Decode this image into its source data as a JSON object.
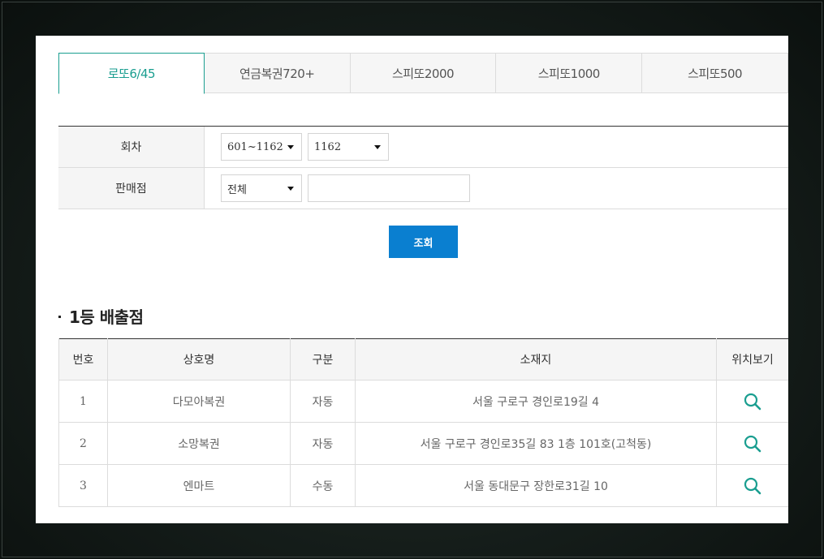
{
  "tabs": [
    {
      "label": "로또6/45",
      "active": true
    },
    {
      "label": "연금복권720+",
      "active": false
    },
    {
      "label": "스피또2000",
      "active": false
    },
    {
      "label": "스피또1000",
      "active": false
    },
    {
      "label": "스피또500",
      "active": false
    }
  ],
  "search": {
    "round_label": "회차",
    "round_range_value": "601~1162",
    "round_value": "1162",
    "store_label": "판매점",
    "region_value": "전체",
    "store_name_value": "",
    "submit_label": "조회"
  },
  "results": {
    "title": "1등 배출점",
    "headers": [
      "번호",
      "상호명",
      "구분",
      "소재지",
      "위치보기"
    ],
    "rows": [
      {
        "no": "1",
        "name": "다모아복권",
        "type": "자동",
        "address": "서울 구로구 경인로19길 4"
      },
      {
        "no": "2",
        "name": "소망복권",
        "type": "자동",
        "address": "서울 구로구 경인로35길 83 1층 101호(고척동)"
      },
      {
        "no": "3",
        "name": "엔마트",
        "type": "수동",
        "address": "서울 동대문구 장한로31길 10"
      }
    ]
  },
  "colors": {
    "accent": "#1a9e90",
    "button": "#0a7fd0",
    "icon": "#1a9e90"
  }
}
